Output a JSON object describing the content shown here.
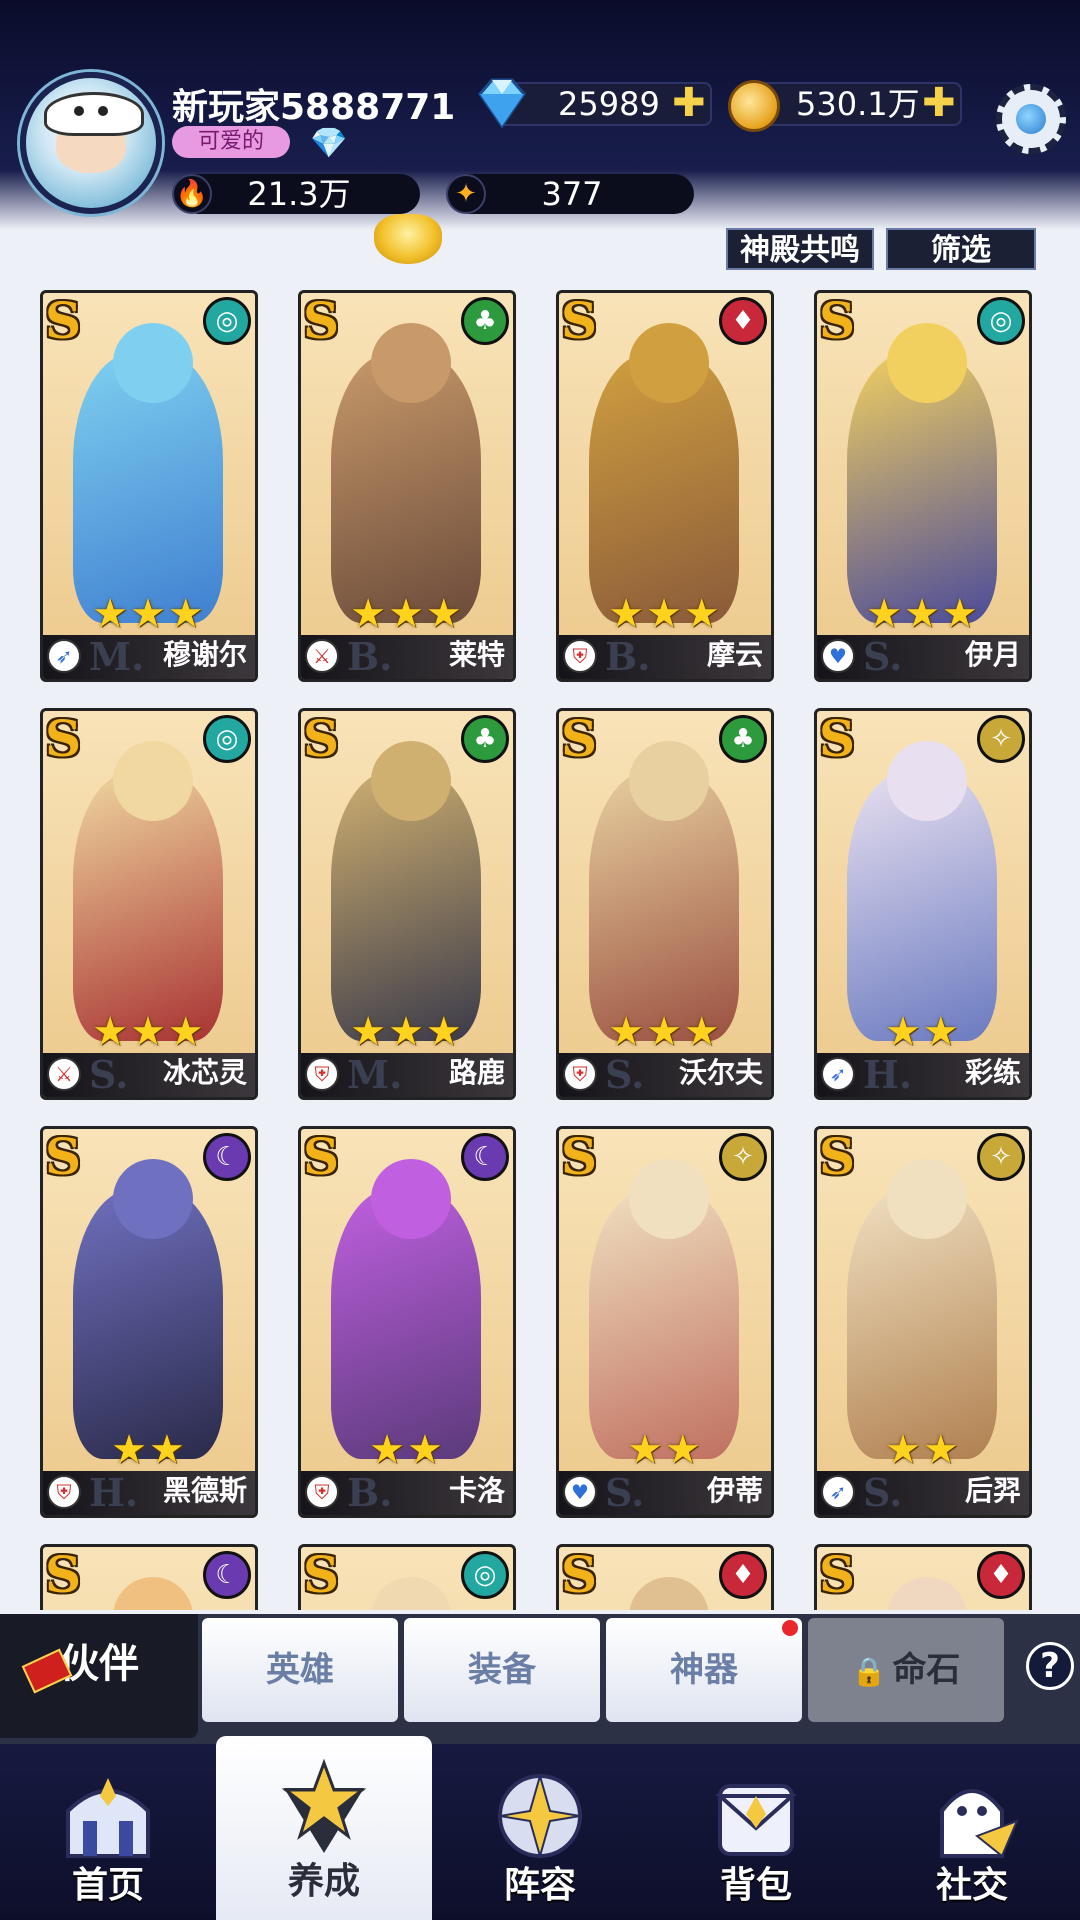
{
  "player": {
    "name": "新玩家5888771",
    "title": "可爱的",
    "power": "21.3万",
    "stars": "377"
  },
  "currency": {
    "diamonds": "25989",
    "gold": "530.1万",
    "plus": "✚"
  },
  "filters": {
    "resonance_label": "神殿共鸣",
    "filter_label": "筛选"
  },
  "colors": {
    "faction_wind": "#22a8a0",
    "faction_forest": "#2e9a3e",
    "faction_fire": "#c8283a",
    "faction_light": "#c9a83a",
    "faction_dark": "#6a3ab0",
    "rank_gold": "#f2b21a",
    "star_yellow": "#ffd21e"
  },
  "heroes": [
    {
      "rank": "S",
      "name": "穆谢尔",
      "class": "M.",
      "stars": "★★★",
      "faction": "wind-icon",
      "role": "mage-icon"
    },
    {
      "rank": "S",
      "name": "莱特",
      "class": "B.",
      "stars": "★★★",
      "faction": "forest-icon",
      "role": "warrior-icon"
    },
    {
      "rank": "S",
      "name": "摩云",
      "class": "B.",
      "stars": "★★★",
      "faction": "fire-icon",
      "role": "tank-icon"
    },
    {
      "rank": "S",
      "name": "伊月",
      "class": "S.",
      "stars": "★★★",
      "faction": "wind-icon",
      "role": "support-icon"
    },
    {
      "rank": "S",
      "name": "冰芯灵",
      "class": "S.",
      "stars": "★★★",
      "faction": "wind-icon",
      "role": "warrior-icon"
    },
    {
      "rank": "S",
      "name": "路鹿",
      "class": "M.",
      "stars": "★★★",
      "faction": "forest-icon",
      "role": "tank-icon"
    },
    {
      "rank": "S",
      "name": "沃尔夫",
      "class": "S.",
      "stars": "★★★",
      "faction": "forest-icon",
      "role": "tank-icon"
    },
    {
      "rank": "S",
      "name": "彩练",
      "class": "H.",
      "stars": "★★",
      "faction": "light-icon",
      "role": "mage-icon"
    },
    {
      "rank": "S",
      "name": "黑德斯",
      "class": "H.",
      "stars": "★★",
      "faction": "dark-icon",
      "role": "tank-icon"
    },
    {
      "rank": "S",
      "name": "卡洛",
      "class": "B.",
      "stars": "★★",
      "faction": "dark-icon",
      "role": "tank-icon"
    },
    {
      "rank": "S",
      "name": "伊蒂",
      "class": "S.",
      "stars": "★★",
      "faction": "light-icon",
      "role": "support-icon"
    },
    {
      "rank": "S",
      "name": "后羿",
      "class": "S.",
      "stars": "★★",
      "faction": "light-icon",
      "role": "mage-icon"
    },
    {
      "rank": "S",
      "name": "",
      "class": "",
      "stars": "",
      "faction": "dark-icon",
      "role": ""
    },
    {
      "rank": "S",
      "name": "",
      "class": "",
      "stars": "",
      "faction": "wind-icon",
      "role": ""
    },
    {
      "rank": "S",
      "name": "",
      "class": "",
      "stars": "",
      "faction": "fire-icon",
      "role": ""
    },
    {
      "rank": "S",
      "name": "",
      "class": "",
      "stars": "",
      "faction": "fire-icon",
      "role": ""
    }
  ],
  "tabs": {
    "partner": "伙伴",
    "hero": "英雄",
    "equipment": "装备",
    "artifact": "神器",
    "fate_stone": "命石",
    "help": "?"
  },
  "nav": {
    "home": "首页",
    "develop": "养成",
    "formation": "阵容",
    "bag": "背包",
    "social": "社交"
  }
}
